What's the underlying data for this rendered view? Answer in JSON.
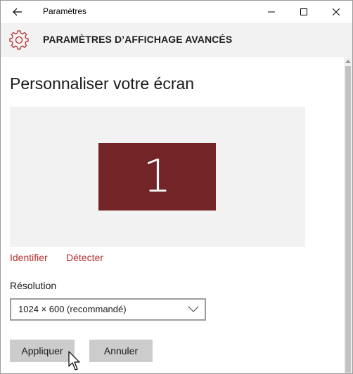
{
  "window": {
    "app_title": "Paramètres"
  },
  "header": {
    "title": "PARAMÈTRES D’AFFICHAGE AVANCÉS",
    "accent_color": "#b5312f"
  },
  "main": {
    "page_title": "Personnaliser votre écran",
    "display_number": "1",
    "display_color": "#722426",
    "links": {
      "identify": "Identifier",
      "detect": "Détecter"
    },
    "resolution": {
      "label": "Résolution",
      "selected": "1024 × 600 (recommandé)"
    },
    "buttons": {
      "apply": "Appliquer",
      "cancel": "Annuler"
    }
  },
  "icons": {
    "back": "back-arrow-icon",
    "minimize": "minimize-icon",
    "maximize": "maximize-icon",
    "close": "close-icon",
    "settings": "gear-icon",
    "dropdown": "chevron-down-icon",
    "pointer": "mouse-cursor-icon"
  }
}
